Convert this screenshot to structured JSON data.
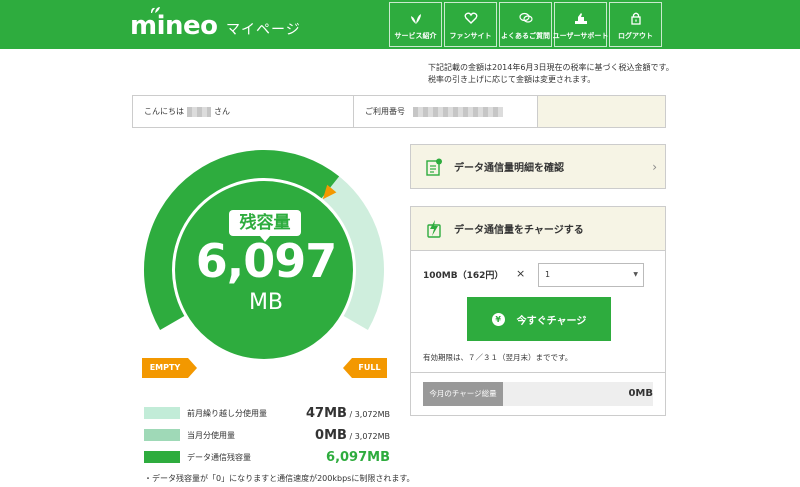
{
  "header": {
    "logo": "mineo",
    "page_title": "マイページ",
    "nav": [
      {
        "label": "サービス紹介",
        "icon": "sprout-icon"
      },
      {
        "label": "ファンサイト",
        "icon": "heart-icon"
      },
      {
        "label": "よくあるご質問",
        "icon": "chat-bubbles-icon"
      },
      {
        "label": "ユーザーサポート",
        "icon": "support-icon"
      },
      {
        "label": "ログアウト",
        "icon": "lock-icon"
      }
    ]
  },
  "notice": {
    "line1": "下記記載の金額は2014年6月3日現在の税率に基づく税込金額です。",
    "line2": "税率の引き上げに応じて金額は変更されます。"
  },
  "greeting": {
    "hello_prefix": "こんにちは",
    "hello_suffix": "さん",
    "number_label": "ご利用番号"
  },
  "gauge": {
    "label": "残容量",
    "value": "6,097",
    "unit": "MB",
    "empty_label": "EMPTY",
    "full_label": "FULL",
    "remaining_fraction": 0.6615,
    "colors": {
      "remaining": "#2eac3e",
      "used": "#cfeedd",
      "accent": "#f39800"
    }
  },
  "legend": [
    {
      "label": "前月繰り越し分使用量",
      "value": "47MB",
      "total": " / 3,072MB",
      "color": "#c2ecd8"
    },
    {
      "label": "当月分使用量",
      "value": "0MB",
      "total": " / 3,072MB",
      "color": "#9fd9b7"
    },
    {
      "label": "データ通信残容量",
      "value": "6,097MB",
      "total": "",
      "color": "#2eac3e"
    }
  ],
  "footnote": "・データ残容量が「0」になりますと通信速度が200kbpsに制限されます。",
  "detail": {
    "label": "データ通信量明細を確認",
    "icon": "document-check-icon"
  },
  "charge": {
    "title": "データ通信量をチャージする",
    "icon": "bolt-tablet-icon",
    "price": "100MB（162円）",
    "times": "×",
    "quantity": "1",
    "button": "今すぐチャージ",
    "button_icon": "yen-icon",
    "expiry": "有効期限は、７／３１（翌月末）までです。",
    "total_label": "今月のチャージ総量",
    "total_value": "0MB"
  }
}
